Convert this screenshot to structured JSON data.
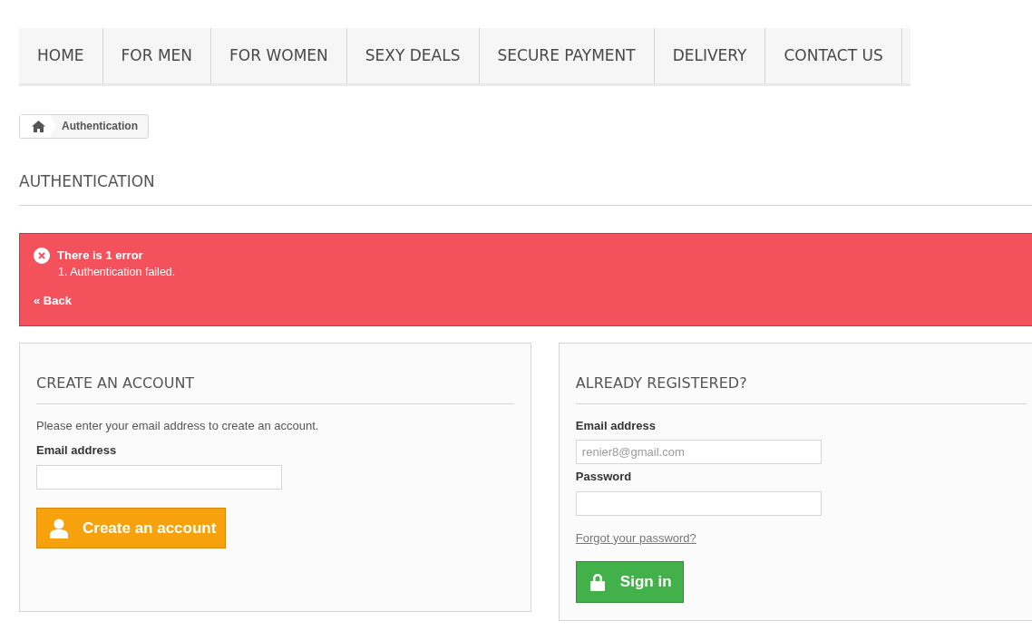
{
  "menu": [
    {
      "label": "HOME"
    },
    {
      "label": "FOR MEN"
    },
    {
      "label": "FOR WOMEN"
    },
    {
      "label": "SEXY DEALS"
    },
    {
      "label": "SECURE PAYMENT"
    },
    {
      "label": "DELIVERY"
    },
    {
      "label": "CONTACT US"
    }
  ],
  "breadcrumb": {
    "current": "Authentication"
  },
  "page_title": "AUTHENTICATION",
  "alert": {
    "title": "There is 1 error",
    "items": [
      "1. Authentication failed."
    ],
    "back_link": "« Back"
  },
  "create_account": {
    "heading": "CREATE AN ACCOUNT",
    "intro": "Please enter your email address to create an account.",
    "email_label": "Email address",
    "button": "Create an account"
  },
  "sign_in": {
    "heading": "ALREADY REGISTERED?",
    "email_label": "Email address",
    "email_value": "renier8@gmail.com",
    "password_label": "Password",
    "forgot_link": "Forgot your password?",
    "button": "Sign in"
  }
}
